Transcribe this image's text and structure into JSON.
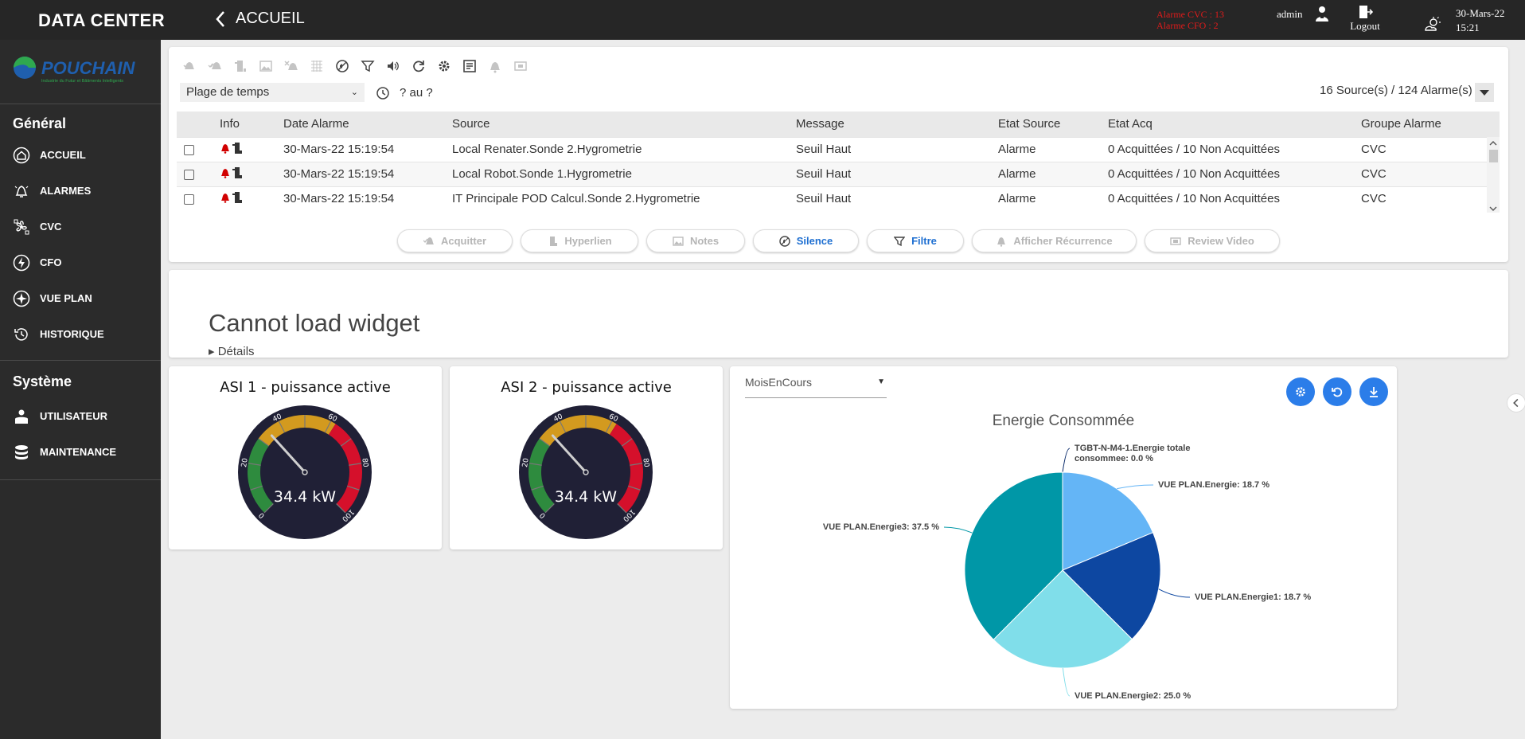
{
  "header": {
    "brand": "DATA CENTER",
    "back_label": "ACCUEIL",
    "alarm_cvc": "Alarme CVC : 13",
    "alarm_cfo": "Alarme CFO : 2",
    "user": "admin",
    "logout": "Logout",
    "date": "30-Mars-22",
    "time": "15:21"
  },
  "sidebar": {
    "logo_text": "POUCHAIN",
    "logo_sub": "Industrie du Futur et Bâtiments Intelligents",
    "general_title": "Général",
    "general_items": [
      {
        "label": "ACCUEIL",
        "icon": "home-icon"
      },
      {
        "label": "ALARMES",
        "icon": "bell-icon"
      },
      {
        "label": "CVC",
        "icon": "fan-icon"
      },
      {
        "label": "CFO",
        "icon": "bolt-icon"
      },
      {
        "label": "VUE PLAN",
        "icon": "compass-icon"
      },
      {
        "label": "HISTORIQUE",
        "icon": "history-icon"
      }
    ],
    "system_title": "Système",
    "system_items": [
      {
        "label": "UTILISATEUR",
        "icon": "user-icon"
      },
      {
        "label": "MAINTENANCE",
        "icon": "database-icon"
      }
    ]
  },
  "alarm_panel": {
    "time_select": "Plage de temps",
    "range": "? au ?",
    "count": "16 Source(s) / 124 Alarme(s)",
    "columns": [
      "Info",
      "Date Alarme",
      "Source",
      "Message",
      "Etat Source",
      "Etat Acq",
      "Groupe Alarme"
    ],
    "rows": [
      {
        "date": "30-Mars-22 15:19:54",
        "source": "Local Renater.Sonde 2.Hygrometrie",
        "message": "Seuil Haut",
        "etat_source": "Alarme",
        "etat_acq": "0 Acquittées / 10 Non Acquittées",
        "groupe": "CVC"
      },
      {
        "date": "30-Mars-22 15:19:54",
        "source": "Local Robot.Sonde 1.Hygrometrie",
        "message": "Seuil Haut",
        "etat_source": "Alarme",
        "etat_acq": "0 Acquittées / 10 Non Acquittées",
        "groupe": "CVC"
      },
      {
        "date": "30-Mars-22 15:19:54",
        "source": "IT Principale POD Calcul.Sonde 2.Hygrometrie",
        "message": "Seuil Haut",
        "etat_source": "Alarme",
        "etat_acq": "0 Acquittées / 10 Non Acquittées",
        "groupe": "CVC"
      }
    ],
    "actions": [
      "Acquitter",
      "Hyperlien",
      "Notes",
      "Silence",
      "Filtre",
      "Afficher Récurrence",
      "Review Video"
    ]
  },
  "widget_error": {
    "title": "Cannot load widget",
    "details": "▸ Détails"
  },
  "gauges": [
    {
      "title": "ASI 1 - puissance active",
      "value_label": "34.4 kW",
      "value": 34.4,
      "ticks": [
        "0",
        "20",
        "40",
        "60",
        "80",
        "100"
      ]
    },
    {
      "title": "ASI 2 - puissance active",
      "value_label": "34.4 kW",
      "value": 34.4,
      "ticks": [
        "0",
        "20",
        "40",
        "60",
        "80",
        "100"
      ]
    }
  ],
  "energy": {
    "period_select": "MoisEnCours",
    "title": "Energie Consommée"
  },
  "chart_data": {
    "type": "pie",
    "title": "Energie Consommée",
    "slices": [
      {
        "name": "TGBT-N-M4-1.Energie totale consommee",
        "value": 0.0,
        "label": "TGBT-N-M4-1.Energie totale consommee: 0.0 %",
        "color": "#0b2c6b"
      },
      {
        "name": "VUE PLAN.Energie",
        "value": 18.7,
        "label": "VUE PLAN.Energie: 18.7 %",
        "color": "#64b5f6"
      },
      {
        "name": "VUE PLAN.Energie1",
        "value": 18.7,
        "label": "VUE PLAN.Energie1: 18.7 %",
        "color": "#0d47a1"
      },
      {
        "name": "VUE PLAN.Energie2",
        "value": 25.0,
        "label": "VUE PLAN.Energie2: 25.0 %",
        "color": "#80deea"
      },
      {
        "name": "VUE PLAN.Energie3",
        "value": 37.5,
        "label": "VUE PLAN.Energie3: 37.5 %",
        "color": "#0097a7"
      }
    ]
  }
}
